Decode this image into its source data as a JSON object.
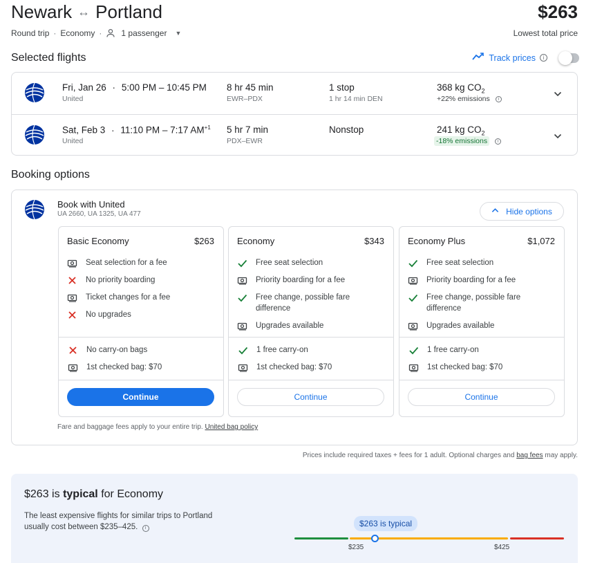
{
  "header": {
    "origin": "Newark",
    "destination": "Portland",
    "swap_icon": "↔",
    "price": "$263",
    "trip_type": "Round trip",
    "cabin": "Economy",
    "passengers": "1 passenger",
    "price_note": "Lowest total price"
  },
  "selected_flights": {
    "title": "Selected flights",
    "track_label": "Track prices",
    "flights": [
      {
        "date": "Fri, Jan 26",
        "times": "5:00 PM – 10:45 PM",
        "times_sup": "",
        "airline": "United",
        "duration": "8 hr 45 min",
        "route": "EWR–PDX",
        "stops": "1 stop",
        "stop_detail": "1 hr 14 min DEN",
        "co2": "368 kg CO",
        "co2_sub": "2",
        "emissions": "+22% emissions"
      },
      {
        "date": "Sat, Feb 3",
        "times": "11:10 PM – 7:17 AM",
        "times_sup": "+1",
        "airline": "United",
        "duration": "5 hr 7 min",
        "route": "PDX–EWR",
        "stops": "Nonstop",
        "stop_detail": "",
        "co2": "241 kg CO",
        "co2_sub": "2",
        "emissions": "-18% emissions"
      }
    ]
  },
  "booking": {
    "title": "Booking options",
    "book_with": "Book with United",
    "flight_numbers": "UA 2660, UA 1325, UA 477",
    "hide_label": "Hide options",
    "fares": [
      {
        "name": "Basic Economy",
        "price": "$263",
        "features": [
          {
            "icon": "money",
            "text": "Seat selection for a fee"
          },
          {
            "icon": "x",
            "text": "No priority boarding"
          },
          {
            "icon": "money",
            "text": "Ticket changes for a fee"
          },
          {
            "icon": "x",
            "text": "No upgrades"
          }
        ],
        "bags": [
          {
            "icon": "x",
            "text": "No carry-on bags"
          },
          {
            "icon": "money",
            "text": "1st checked bag: $70"
          }
        ],
        "button": "Continue"
      },
      {
        "name": "Economy",
        "price": "$343",
        "features": [
          {
            "icon": "check",
            "text": "Free seat selection"
          },
          {
            "icon": "money",
            "text": "Priority boarding for a fee"
          },
          {
            "icon": "check",
            "text": "Free change, possible fare difference"
          },
          {
            "icon": "money",
            "text": "Upgrades available"
          }
        ],
        "bags": [
          {
            "icon": "check",
            "text": "1 free carry-on"
          },
          {
            "icon": "money",
            "text": "1st checked bag: $70"
          }
        ],
        "button": "Continue"
      },
      {
        "name": "Economy Plus",
        "price": "$1,072",
        "features": [
          {
            "icon": "check",
            "text": "Free seat selection"
          },
          {
            "icon": "money",
            "text": "Priority boarding for a fee"
          },
          {
            "icon": "check",
            "text": "Free change, possible fare difference"
          },
          {
            "icon": "money",
            "text": "Upgrades available"
          }
        ],
        "bags": [
          {
            "icon": "check",
            "text": "1 free carry-on"
          },
          {
            "icon": "money",
            "text": "1st checked bag: $70"
          }
        ],
        "button": "Continue"
      }
    ],
    "fees_note": "Fare and baggage fees apply to your entire trip.",
    "bag_policy_link": "United bag policy"
  },
  "prices_note": {
    "text": "Prices include required taxes + fees for 1 adult. Optional charges and",
    "link": "bag fees",
    "suffix": "may apply."
  },
  "typical": {
    "price": "$263",
    "is": "is",
    "level": "typical",
    "for": "for Economy",
    "description": "The least expensive flights for similar trips to Portland usually cost between $235–425.",
    "pill": "$263 is typical",
    "low_tick": "$235",
    "high_tick": "$425",
    "range_low": 235,
    "range_high": 425,
    "current": 263
  },
  "colors": {
    "accent": "#1a73e8",
    "check": "#188038",
    "cross": "#d93025",
    "bar_green": "#1e8e3e",
    "bar_yellow": "#f9ab00",
    "bar_red": "#d93025"
  }
}
